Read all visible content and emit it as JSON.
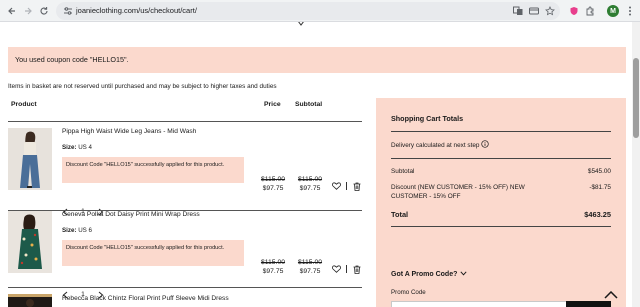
{
  "browser": {
    "url": "joanieclothing.com/us/checkout/cart/",
    "profile_initial": "M",
    "icons": {
      "back": "arrow-left-icon",
      "forward": "arrow-right-icon",
      "reload": "reload-icon",
      "site_info": "tune-icon",
      "translate": "translate-icon",
      "card": "credit-card-icon",
      "bookmark": "star-icon",
      "extension_shield": "shield-icon",
      "extensions": "puzzle-icon",
      "menu": "kebab-menu-icon"
    }
  },
  "coupon_banner": {
    "text": "You used coupon code \"HELLO15\"."
  },
  "basket_note": "Items in basket are not reserved until purchased and may be subject to higher taxes and duties",
  "table_headers": {
    "product": "Product",
    "price": "Price",
    "subtotal": "Subtotal"
  },
  "items": [
    {
      "name": "Pippa High Waist Wide Leg Jeans - Mid Wash",
      "size_label": "Size:",
      "size": "US 4",
      "discount": "Discount Code \"HELLO15\" successfully applied for this product.",
      "qty": "1",
      "price_was": "$115.00",
      "price_now": "$97.75",
      "subtotal_was": "$115.00",
      "subtotal_now": "$97.75"
    },
    {
      "name": "Geneva Polka Dot Daisy Print Mini Wrap Dress",
      "size_label": "Size:",
      "size": "US 6",
      "discount": "Discount Code \"HELLO15\" successfully applied for this product.",
      "qty": "1",
      "price_was": "$115.00",
      "price_now": "$97.75",
      "subtotal_was": "$115.00",
      "subtotal_now": "$97.75"
    },
    {
      "name": "Rebecca Black Chintz Floral Print Puff Sleeve Midi Dress"
    }
  ],
  "totals": {
    "title": "Shopping Cart Totals",
    "delivery_note": "Delivery calculated at next step",
    "subtotal_label": "Subtotal",
    "subtotal_value": "$545.00",
    "discount_label": "Discount (NEW CUSTOMER - 15% OFF) NEW CUSTOMER - 15% OFF",
    "discount_value": "-$81.75",
    "total_label": "Total",
    "total_value": "$463.25",
    "promo_toggle": "Got A Promo Code?",
    "promo_label": "Promo Code"
  },
  "colors": {
    "accent_bg": "#fbd9cd",
    "text": "#1a1a1a",
    "rule": "#555555"
  }
}
